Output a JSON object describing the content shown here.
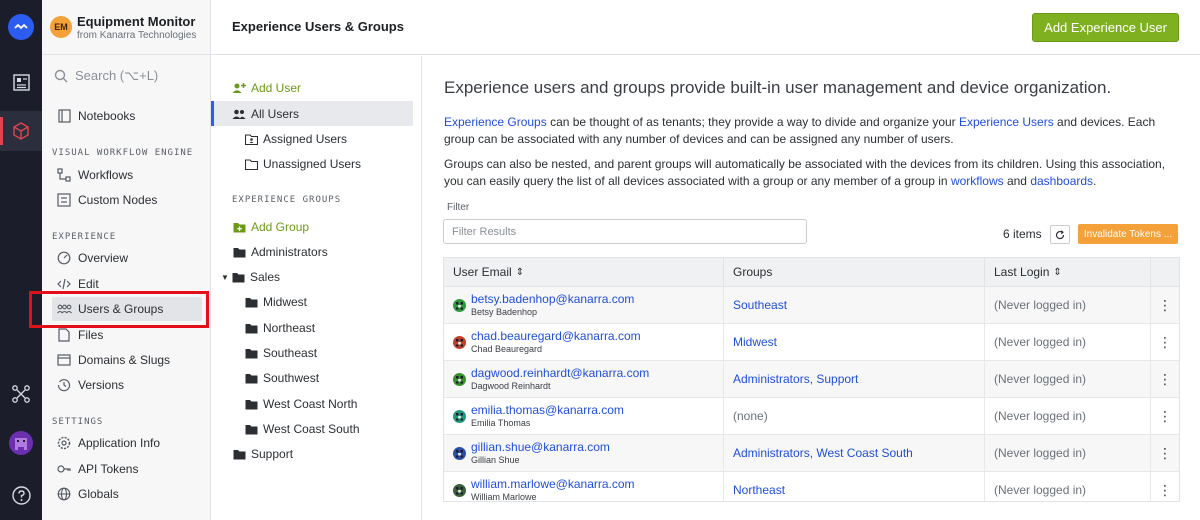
{
  "app": {
    "badge": "EM",
    "name": "Equipment Monitor",
    "org": "from Kanarra Technologies",
    "colors": {
      "badge": "#f5a13a",
      "accent": "#2c5cf0",
      "green": "#7fb020",
      "orange": "#f5a13a",
      "highlight": "#e3101a"
    }
  },
  "sidebar": {
    "search_placeholder": "Search (⌥+L)",
    "notebooks": "Notebooks",
    "section_workflow": "VISUAL WORKFLOW ENGINE",
    "workflows": "Workflows",
    "custom_nodes": "Custom Nodes",
    "section_experience": "EXPERIENCE",
    "overview": "Overview",
    "edit": "Edit",
    "users_groups": "Users & Groups",
    "files": "Files",
    "domains": "Domains & Slugs",
    "versions": "Versions",
    "section_settings": "SETTINGS",
    "app_info": "Application Info",
    "api_tokens": "API Tokens",
    "globals": "Globals"
  },
  "header": {
    "title": "Experience Users & Groups",
    "add_button": "Add Experience User"
  },
  "ug_nav": {
    "add_user": "Add User",
    "all_users": "All Users",
    "assigned": "Assigned Users",
    "unassigned": "Unassigned Users",
    "section_groups": "EXPERIENCE GROUPS",
    "add_group": "Add Group",
    "groups": {
      "administrators": "Administrators",
      "sales": "Sales",
      "midwest": "Midwest",
      "northeast": "Northeast",
      "southeast": "Southeast",
      "southwest": "Southwest",
      "west_coast_north": "West Coast North",
      "west_coast_south": "West Coast South",
      "support": "Support"
    }
  },
  "main": {
    "intro": "Experience users and groups provide built-in user management and device organization.",
    "p1": {
      "link1": "Experience Groups",
      "t1": " can be thought of as tenants; they provide a way to divide and organize your ",
      "link2": "Experience Users",
      "t2": " and devices. Each group can be associated with any number of devices and can be assigned any number of users."
    },
    "p2": {
      "t1": "Groups can also be nested, and parent groups will automatically be associated with the devices from its children. Using this association, you can easily query the list of all devices associated with a group or any member of a group in ",
      "link1": "workflows",
      "t2": " and ",
      "link2": "dashboards",
      "t3": "."
    },
    "filter_label": "Filter",
    "filter_placeholder": "Filter Results",
    "items_count": "6 items",
    "invalidate": "Invalidate Tokens ...",
    "columns": {
      "email": "User Email",
      "groups": "Groups",
      "last_login": "Last Login"
    },
    "rows": [
      {
        "email": "betsy.badenhop@kanarra.com",
        "name": "Betsy Badenhop",
        "groups": "Southeast",
        "last_login": "(Never logged in)",
        "avatar": "#2e9a3c"
      },
      {
        "email": "chad.beauregard@kanarra.com",
        "name": "Chad Beauregard",
        "groups": "Midwest",
        "last_login": "(Never logged in)",
        "avatar": "#c2402a"
      },
      {
        "email": "dagwood.reinhardt@kanarra.com",
        "name": "Dagwood Reinhardt",
        "groups": "Administrators, Support",
        "last_login": "(Never logged in)",
        "avatar": "#3a8f2e"
      },
      {
        "email": "emilia.thomas@kanarra.com",
        "name": "Emilia Thomas",
        "groups": "(none)",
        "last_login": "(Never logged in)",
        "avatar": "#1e9a7a"
      },
      {
        "email": "gillian.shue@kanarra.com",
        "name": "Gillian Shue",
        "groups": "Administrators, West Coast South",
        "last_login": "(Never logged in)",
        "avatar": "#2a4fa8"
      },
      {
        "email": "william.marlowe@kanarra.com",
        "name": "William Marlowe",
        "groups": "Northeast",
        "last_login": "(Never logged in)",
        "avatar": "#3b5f3a"
      }
    ]
  }
}
